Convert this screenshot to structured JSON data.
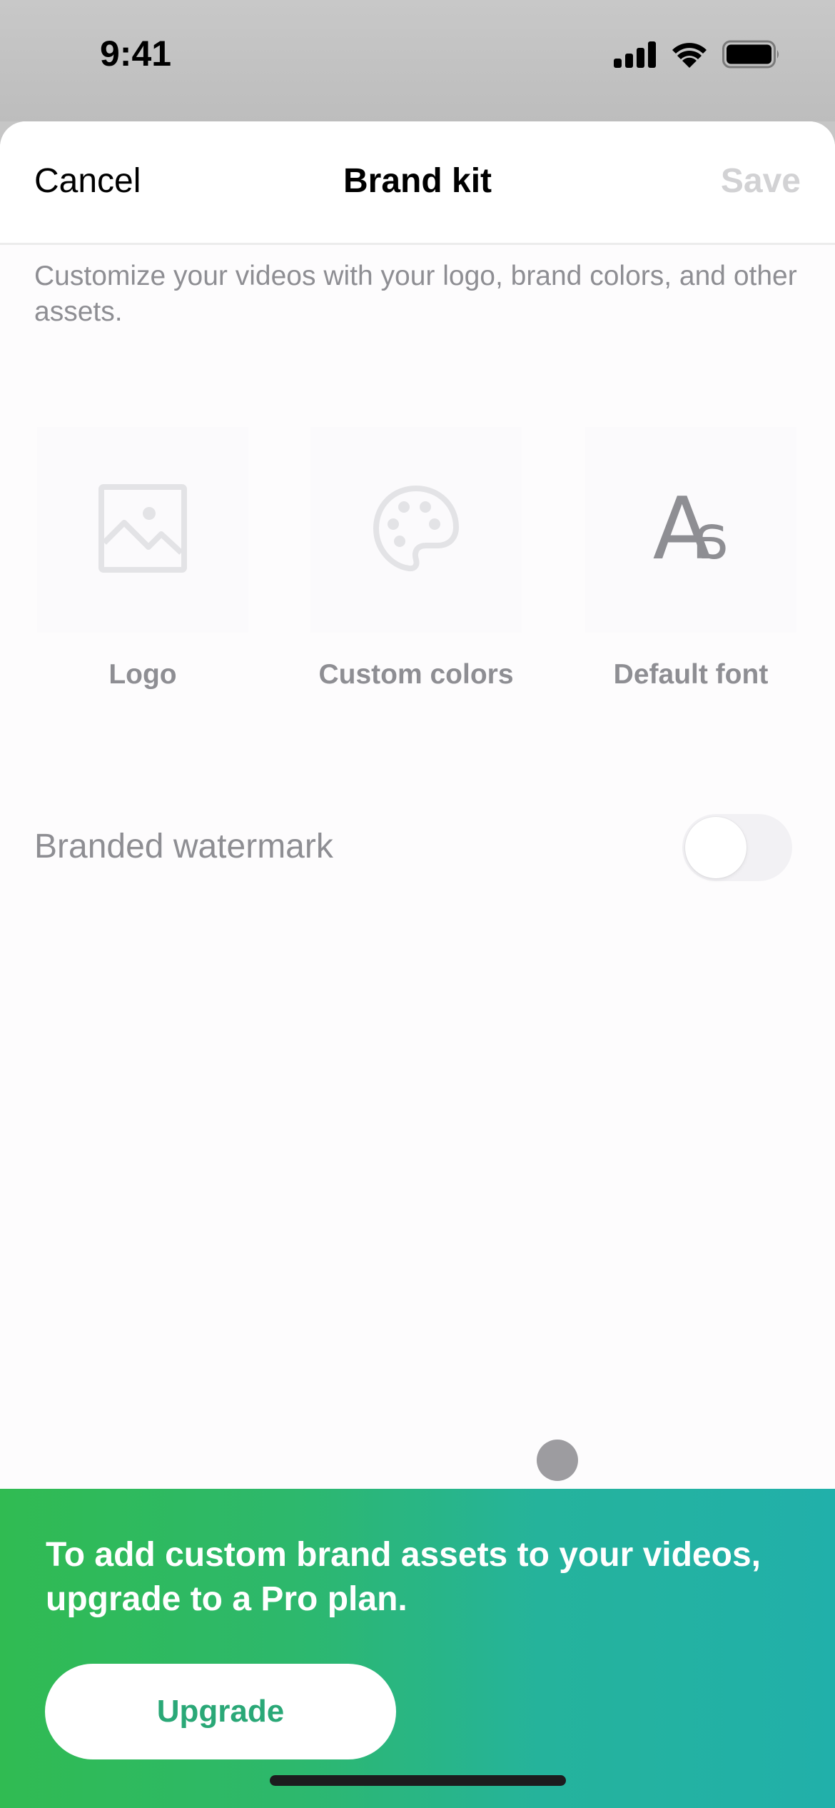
{
  "status_bar": {
    "time": "9:41",
    "icons": [
      "cellular-signal-icon",
      "wifi-icon",
      "battery-icon"
    ]
  },
  "nav": {
    "cancel_label": "Cancel",
    "title": "Brand kit",
    "save_label": "Save"
  },
  "description": "Customize your videos with your logo, brand colors, and other assets.",
  "tiles": [
    {
      "label": "Logo",
      "icon": "image-icon"
    },
    {
      "label": "Custom colors",
      "icon": "palette-icon"
    },
    {
      "label": "Default font",
      "icon": "font-icon",
      "glyph_upper": "A",
      "glyph_lower": "a"
    }
  ],
  "watermark": {
    "label": "Branded watermark",
    "enabled": false
  },
  "promo": {
    "text": "To add custom brand assets to your videos, upgrade to a Pro plan.",
    "button_label": "Upgrade",
    "gradient_start": "#30bb52",
    "gradient_end": "#21b0aa",
    "button_text_color": "#2aa877"
  }
}
